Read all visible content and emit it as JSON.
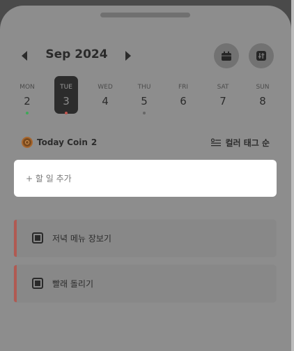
{
  "header": {
    "month_label": "Sep 2024",
    "prev_icon": "chevron-left-icon",
    "next_icon": "chevron-right-icon",
    "calendar_icon": "calendar-icon",
    "filter_icon": "sliders-icon"
  },
  "week": [
    {
      "name": "MON",
      "num": "2",
      "dot": "#3ea957"
    },
    {
      "name": "TUE",
      "num": "3",
      "dot": "#c1554e",
      "selected": true
    },
    {
      "name": "WED",
      "num": "4"
    },
    {
      "name": "THU",
      "num": "5",
      "dot": "#666666"
    },
    {
      "name": "FRI",
      "num": "6"
    },
    {
      "name": "SAT",
      "num": "7"
    },
    {
      "name": "SUN",
      "num": "8"
    }
  ],
  "coin": {
    "label": "Today Coin",
    "count": "2"
  },
  "sort": {
    "label": "컬러 태그 순"
  },
  "add_task": {
    "placeholder": "+ 할 일 추가"
  },
  "todos": [
    {
      "text": "저녁 메뉴 장보기",
      "tag_color": "#b05a52"
    },
    {
      "text": "빨래 돌리기",
      "tag_color": "#b05a52"
    }
  ]
}
